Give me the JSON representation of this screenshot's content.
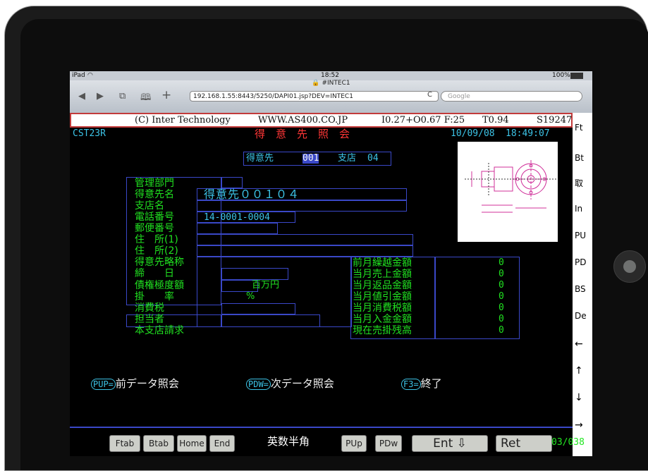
{
  "device": {
    "label": "iPad",
    "time": "18:52",
    "battery": "100%"
  },
  "browser": {
    "page_title": "#INTEC1",
    "url": "192.168.1.55:8443/5250/DAPI01.jsp?DEV=INTEC1",
    "search_placeholder": "Google"
  },
  "header": {
    "copyright": "(C) Inter Technology",
    "site": "WWW.AS400.CO.JP",
    "io": "I0.27+O0.67 F:25",
    "t": "T0.94",
    "s": "S19247"
  },
  "screen": {
    "program": "CST23R",
    "title": "得　意　先　照　会",
    "date": "10/09/08",
    "time": "18:49:07",
    "key_customer_label": "得意先",
    "key_customer_value": "001",
    "key_branch_label": "支店",
    "key_branch_value": "04",
    "fields_left": [
      {
        "label": "管理部門",
        "value": ""
      },
      {
        "label": "得意先名",
        "value": "得意先００１０４"
      },
      {
        "label": "支店名",
        "value": ""
      },
      {
        "label": "電話番号",
        "value": "14-0001-0004"
      },
      {
        "label": "郵便番号",
        "value": ""
      },
      {
        "label": "住　所(1)",
        "value": ""
      },
      {
        "label": "住　所(2)",
        "value": ""
      },
      {
        "label": "得意先略称",
        "value": ""
      },
      {
        "label": "締　　日",
        "value": ""
      },
      {
        "label": "債権極度額",
        "value": "百万円"
      },
      {
        "label": "掛　　率",
        "value": "%"
      },
      {
        "label": "消費税",
        "value": ""
      },
      {
        "label": "担当者",
        "value": ""
      },
      {
        "label": "本支店請求",
        "value": ""
      }
    ],
    "fields_right": [
      {
        "label": "前月繰越金額",
        "value": "0"
      },
      {
        "label": "当月売上金額",
        "value": "0"
      },
      {
        "label": "当月返品金額",
        "value": "0"
      },
      {
        "label": "当月値引金額",
        "value": "0"
      },
      {
        "label": "当月消費税額",
        "value": "0"
      },
      {
        "label": "当月入金金額",
        "value": "0"
      },
      {
        "label": "現在売掛残高",
        "value": "0"
      }
    ],
    "fkeys": [
      {
        "key": "PUP=",
        "label": "前データ照会"
      },
      {
        "key": "PDW=",
        "label": "次データ照会"
      },
      {
        "key": "F3=",
        "label": "終了"
      }
    ]
  },
  "side_buttons": [
    "Ft",
    "Bt",
    "取",
    "In",
    "PU",
    "PD",
    "BS",
    "De",
    "←",
    "↑",
    "↓",
    "→"
  ],
  "bottom_keys": [
    "Ftab",
    "Btab",
    "Home",
    "End",
    "PUp",
    "PDw",
    "Ent ⇩",
    "Ret"
  ],
  "ime_mode": "英数半角",
  "cursor_pos": "03/038"
}
